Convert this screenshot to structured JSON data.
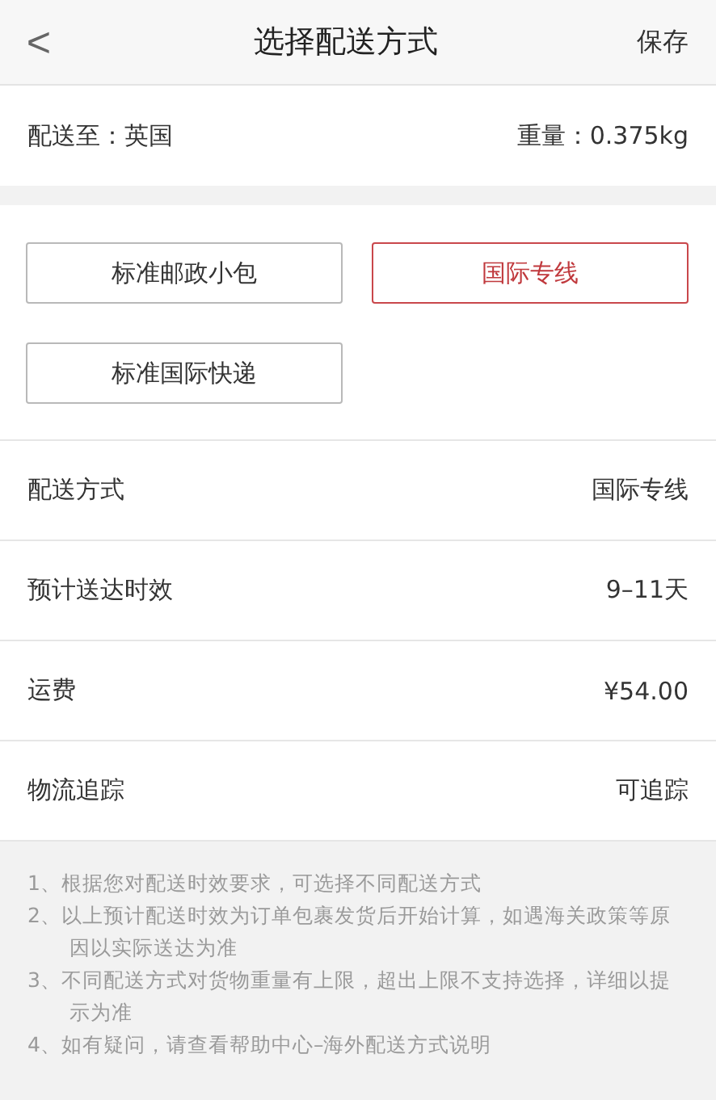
{
  "header": {
    "back": "<",
    "title": "选择配送方式",
    "action": "保存"
  },
  "destination": {
    "label": "配送至：英国",
    "weight": "重量：0.375kg"
  },
  "methods": [
    {
      "label": "标准邮政小包",
      "selected": false
    },
    {
      "label": "国际专线",
      "selected": true
    },
    {
      "label": "标准国际快递",
      "selected": false
    }
  ],
  "details": [
    {
      "label": "配送方式",
      "value": "国际专线"
    },
    {
      "label": "预计送达时效",
      "value": "9–11天"
    },
    {
      "label": "运费",
      "value": "¥54.00"
    },
    {
      "label": "物流追踪",
      "value": "可追踪"
    }
  ],
  "notes": [
    "1、根据您对配送时效要求，可选择不同配送方式",
    "2、以上预计配送时效为订单包裹发货后开始计算，如遇海关政策等原因以实际送达为准",
    "3、不同配送方式对货物重量有上限，超出上限不支持选择，详细以提示为准",
    "4、如有疑问，请查看帮助中心–海外配送方式说明"
  ]
}
